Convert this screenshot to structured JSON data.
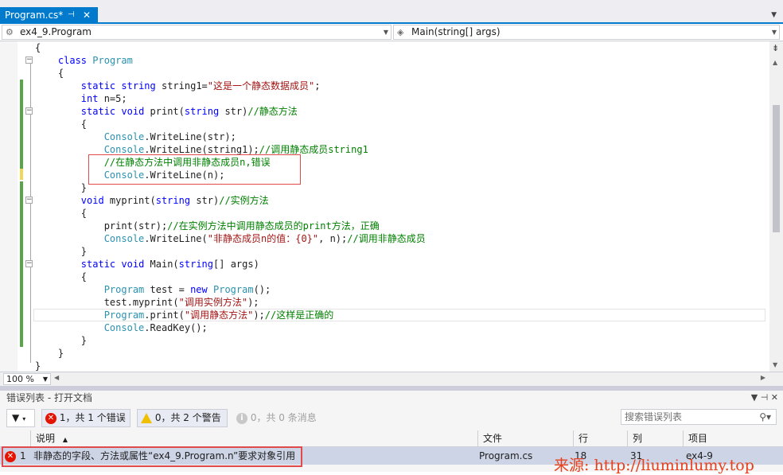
{
  "tab": {
    "title": "Program.cs*",
    "pin": "⊣",
    "close": "✕"
  },
  "nav": {
    "left": "ex4_9.Program",
    "right": "Main(string[] args)"
  },
  "code_lines": [
    [
      {
        "t": "{",
        "c": ""
      }
    ],
    [
      {
        "t": "    ",
        "c": ""
      },
      {
        "t": "class",
        "c": "kw"
      },
      {
        "t": " ",
        "c": ""
      },
      {
        "t": "Program",
        "c": "ty"
      }
    ],
    [
      {
        "t": "    {",
        "c": ""
      }
    ],
    [
      {
        "t": "        ",
        "c": ""
      },
      {
        "t": "static",
        "c": "kw"
      },
      {
        "t": " ",
        "c": ""
      },
      {
        "t": "string",
        "c": "kw"
      },
      {
        "t": " string1=",
        "c": ""
      },
      {
        "t": "\"这是一个静态数据成员\"",
        "c": "str"
      },
      {
        "t": ";",
        "c": ""
      }
    ],
    [
      {
        "t": "        ",
        "c": ""
      },
      {
        "t": "int",
        "c": "kw"
      },
      {
        "t": " n=5;",
        "c": ""
      }
    ],
    [
      {
        "t": "        ",
        "c": ""
      },
      {
        "t": "static",
        "c": "kw"
      },
      {
        "t": " ",
        "c": ""
      },
      {
        "t": "void",
        "c": "kw"
      },
      {
        "t": " print(",
        "c": ""
      },
      {
        "t": "string",
        "c": "kw"
      },
      {
        "t": " str)",
        "c": ""
      },
      {
        "t": "//静态方法",
        "c": "cm"
      }
    ],
    [
      {
        "t": "        {",
        "c": ""
      }
    ],
    [
      {
        "t": "            ",
        "c": ""
      },
      {
        "t": "Console",
        "c": "ty"
      },
      {
        "t": ".WriteLine(str);",
        "c": ""
      }
    ],
    [
      {
        "t": "            ",
        "c": ""
      },
      {
        "t": "Console",
        "c": "ty"
      },
      {
        "t": ".WriteLine(string1);",
        "c": ""
      },
      {
        "t": "//调用静态成员string1",
        "c": "cm"
      }
    ],
    [
      {
        "t": "            ",
        "c": ""
      },
      {
        "t": "//在静态方法中调用非静态成员n,错误",
        "c": "cm"
      }
    ],
    [
      {
        "t": "            ",
        "c": ""
      },
      {
        "t": "Console",
        "c": "ty"
      },
      {
        "t": ".WriteLine(n);",
        "c": ""
      }
    ],
    [
      {
        "t": "        }",
        "c": ""
      }
    ],
    [
      {
        "t": "        ",
        "c": ""
      },
      {
        "t": "void",
        "c": "kw"
      },
      {
        "t": " myprint(",
        "c": ""
      },
      {
        "t": "string",
        "c": "kw"
      },
      {
        "t": " str)",
        "c": ""
      },
      {
        "t": "//实例方法",
        "c": "cm"
      }
    ],
    [
      {
        "t": "        {",
        "c": ""
      }
    ],
    [
      {
        "t": "            print(str);",
        "c": ""
      },
      {
        "t": "//在实例方法中调用静态成员的print方法，正确",
        "c": "cm"
      }
    ],
    [
      {
        "t": "            ",
        "c": ""
      },
      {
        "t": "Console",
        "c": "ty"
      },
      {
        "t": ".WriteLine(",
        "c": ""
      },
      {
        "t": "\"非静态成员n的值：{0}\"",
        "c": "str"
      },
      {
        "t": ", n);",
        "c": ""
      },
      {
        "t": "//调用非静态成员",
        "c": "cm"
      }
    ],
    [
      {
        "t": "        }",
        "c": ""
      }
    ],
    [
      {
        "t": "        ",
        "c": ""
      },
      {
        "t": "static",
        "c": "kw"
      },
      {
        "t": " ",
        "c": ""
      },
      {
        "t": "void",
        "c": "kw"
      },
      {
        "t": " Main(",
        "c": ""
      },
      {
        "t": "string",
        "c": "kw"
      },
      {
        "t": "[] args)",
        "c": ""
      }
    ],
    [
      {
        "t": "        {",
        "c": ""
      }
    ],
    [
      {
        "t": "            ",
        "c": ""
      },
      {
        "t": "Program",
        "c": "ty"
      },
      {
        "t": " test = ",
        "c": ""
      },
      {
        "t": "new",
        "c": "kw"
      },
      {
        "t": " ",
        "c": ""
      },
      {
        "t": "Program",
        "c": "ty"
      },
      {
        "t": "();",
        "c": ""
      }
    ],
    [
      {
        "t": "            test.myprint(",
        "c": ""
      },
      {
        "t": "\"调用实例方法\"",
        "c": "str"
      },
      {
        "t": ");",
        "c": ""
      }
    ],
    [
      {
        "t": "            ",
        "c": ""
      },
      {
        "t": "Program",
        "c": "ty"
      },
      {
        "t": ".print(",
        "c": ""
      },
      {
        "t": "\"调用静态方法\"",
        "c": "str"
      },
      {
        "t": ");",
        "c": ""
      },
      {
        "t": "//这样是正确的",
        "c": "cm"
      }
    ],
    [
      {
        "t": "            ",
        "c": ""
      },
      {
        "t": "Console",
        "c": "ty"
      },
      {
        "t": ".ReadKey();",
        "c": ""
      }
    ],
    [
      {
        "t": "        }",
        "c": ""
      }
    ],
    [
      {
        "t": "    }",
        "c": ""
      }
    ],
    [
      {
        "t": "}",
        "c": ""
      }
    ]
  ],
  "zoom": "100 %",
  "error_list": {
    "title": "错误列表 - 打开文档",
    "errors_btn": "1，共 1 个错误",
    "warnings_btn": "0，共 2 个警告",
    "messages_btn": "0，共 0 条消息",
    "search_placeholder": "搜索错误列表",
    "headers": {
      "desc": "说明",
      "file": "文件",
      "line": "行",
      "col": "列",
      "project": "项目"
    },
    "rows": [
      {
        "num": "1",
        "desc": "非静态的字段、方法或属性“ex4_9.Program.n”要求对象引用",
        "file": "Program.cs",
        "line": "18",
        "col": "31",
        "project": "ex4-9"
      }
    ]
  },
  "watermark": "来源: http://liuminlumy.top"
}
